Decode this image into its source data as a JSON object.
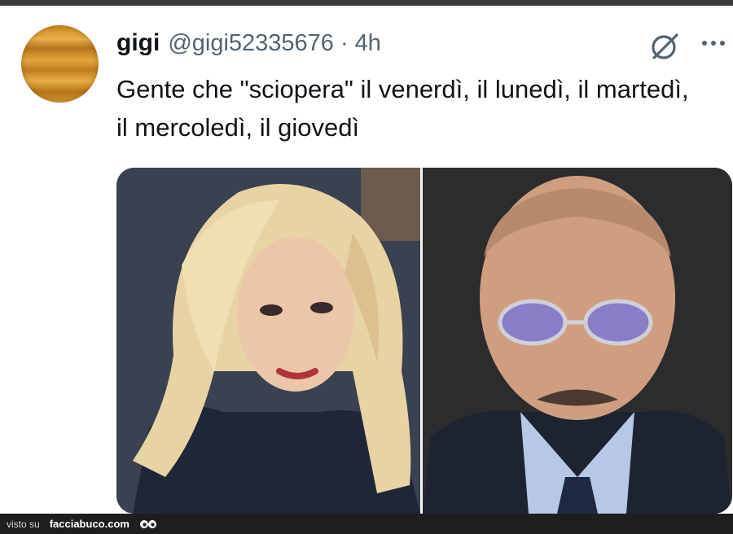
{
  "tweet": {
    "author": {
      "name": "gigi",
      "handle": "@gigi52335676",
      "separator": "·",
      "time": "4h"
    },
    "text": "Gente che \"sciopera\" il venerdì, il lunedì, il martedì, il mercoledì, il giovedì",
    "actions": {
      "grok_icon": "grok-icon",
      "more_icon": "more-dots-icon"
    },
    "media": [
      {
        "icon": "photo-woman-blonde"
      },
      {
        "icon": "photo-elderly-man-sunglasses"
      }
    ]
  },
  "footer": {
    "visto": "visto su",
    "site": "facciabuco.com",
    "icon": "owl-eyes-icon"
  },
  "colors": {
    "text": "#0f1419",
    "secondary": "#536471",
    "footer_bg": "#1e1e1e"
  }
}
